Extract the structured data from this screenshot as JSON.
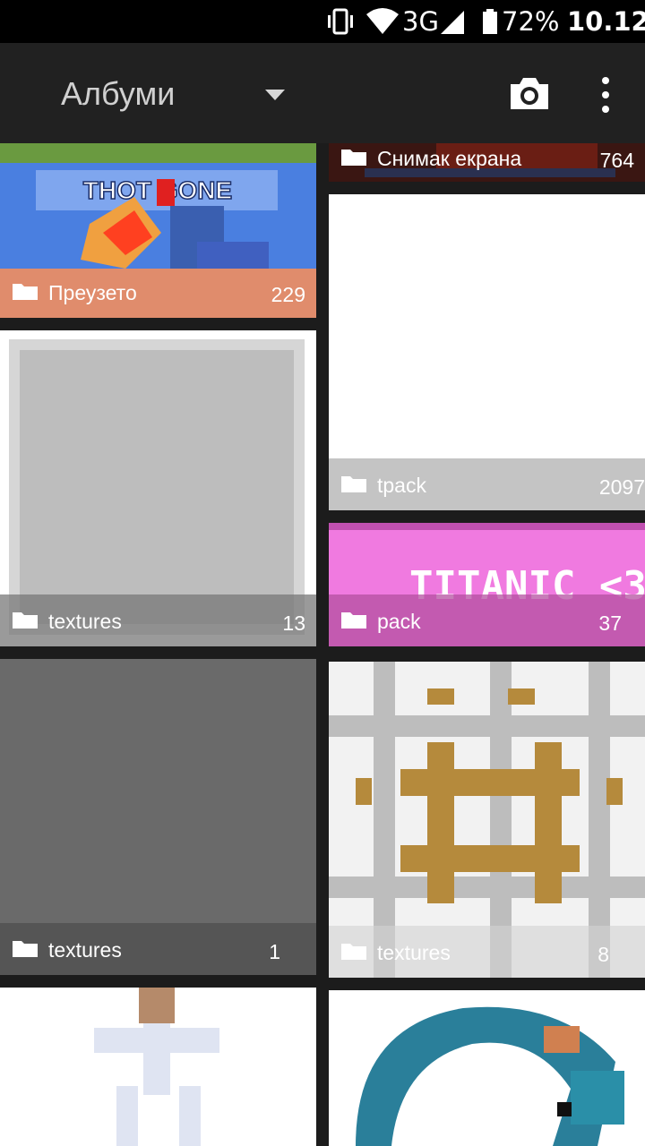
{
  "status_bar": {
    "network": "3G",
    "battery": "72%",
    "time": "10.12"
  },
  "action_bar": {
    "title": "Албуми"
  },
  "albums": [
    {
      "name": "Преузето",
      "count": "229"
    },
    {
      "name": "Снимак екрана",
      "count": "764"
    },
    {
      "name": "tpack",
      "count": "2097"
    },
    {
      "name": "textures",
      "count": "13"
    },
    {
      "name": "pack",
      "count": "37"
    },
    {
      "name": "textures",
      "count": "1"
    },
    {
      "name": "textures",
      "count": "8"
    }
  ],
  "thumbnail_texts": {
    "poster": "THOT GONE",
    "titanic": "TITANIC <3"
  },
  "colors": {
    "status_bar": "#000000",
    "action_bar": "#212121",
    "background": "#1c1c1c",
    "pink": "#f07ae0"
  }
}
